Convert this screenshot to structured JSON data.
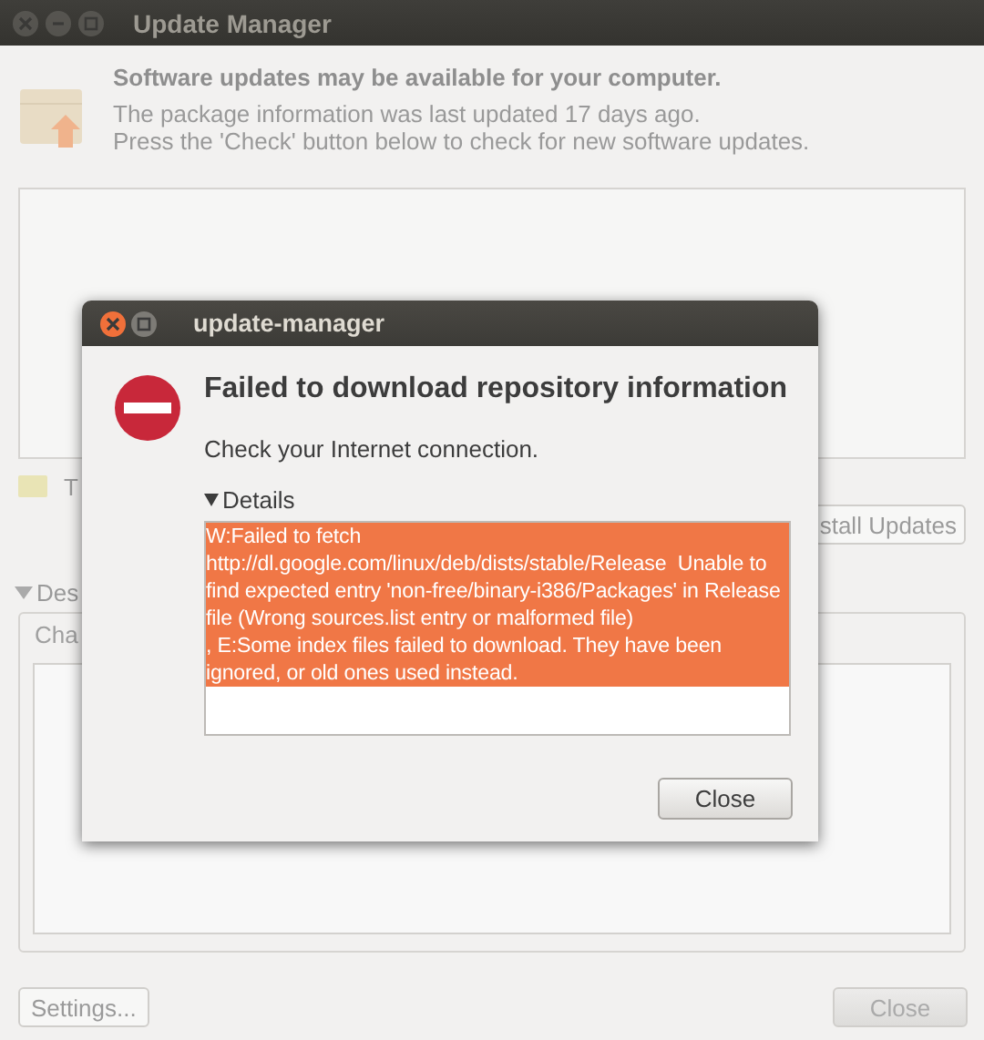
{
  "window": {
    "title": "Update Manager"
  },
  "header": {
    "title": "Software updates may be available for your computer.",
    "lines": [
      "The package information was last updated 17 days ago.",
      "Press the 'Check' button below to check for new software updates."
    ]
  },
  "status_text": "T",
  "install_button": {
    "label": "stall Updates"
  },
  "description": {
    "label": "Des",
    "expanded": true
  },
  "description_tabs": [
    {
      "label": "Cha",
      "selected": true
    }
  ],
  "buttons": [
    {
      "label": "Settings...",
      "disabled": false
    },
    {
      "label": "Close",
      "disabled": true
    }
  ],
  "dialog": {
    "title": "update-manager",
    "heading": "Failed to download repository information",
    "message": "Check your Internet connection.",
    "details": {
      "label": "Details",
      "expanded": true,
      "selected": true,
      "text": "W:Failed to fetch http://dl.google.com/linux/deb/dists/stable/Release  Unable to find expected entry 'non-free/binary-i386/Packages' in Release file (Wrong sources.list entry or malformed file)\n, E:Some index files failed to download. They have been ignored, or old ones used instead."
    },
    "buttons": [
      {
        "label": "Close"
      }
    ]
  }
}
